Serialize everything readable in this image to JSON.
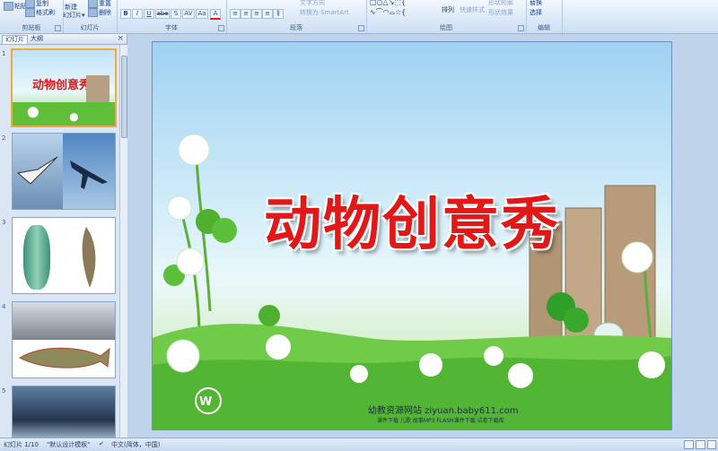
{
  "ribbon": {
    "clipboard": {
      "label": "剪贴板",
      "paste": "粘贴",
      "copy": "复制",
      "format_painter": "格式刷"
    },
    "slides": {
      "label": "幻灯片",
      "new_slide": "新建",
      "new_slide_sub": "幻灯片▾",
      "reset": "重置",
      "delete": "删除"
    },
    "font": {
      "label": "字体",
      "bold": "B",
      "italic": "I",
      "underline": "U",
      "strike": "abe",
      "shadow": "S",
      "spacing": "AV",
      "case": "Aa",
      "color": "A"
    },
    "paragraph": {
      "label": "段落",
      "text_direction": "文字方向",
      "convert_smartart": "转换为 SmartArt"
    },
    "drawing": {
      "label": "绘图",
      "arrange": "排列",
      "quick_styles": "快速样式",
      "shape_outline": "形状轮廓",
      "shape_effects": "形状效果"
    },
    "editing": {
      "label": "编辑",
      "replace": "替换",
      "select": "选择"
    }
  },
  "panel": {
    "tabs": [
      "幻灯片",
      "大纲"
    ],
    "close": "×",
    "thumbnails": [
      {
        "num": "1",
        "title": "动物创意秀"
      },
      {
        "num": "2"
      },
      {
        "num": "3"
      },
      {
        "num": "4"
      },
      {
        "num": "5"
      }
    ]
  },
  "slide": {
    "title": "动物创意秀",
    "footer_site": "幼教资源网站  ziyuan.baby611.com",
    "footer_links": "课件下载   儿歌   故事MP3   FLASH课件下载   试卷下载库"
  },
  "status": {
    "slide_counter": "幻灯片 1/10",
    "theme": "\"默认设计模板\"",
    "language": "中文(简体，中国)"
  },
  "colors": {
    "title_red": "#e21818",
    "ribbon_blue": "#dbe8f7",
    "accent": "#f2a93b"
  }
}
